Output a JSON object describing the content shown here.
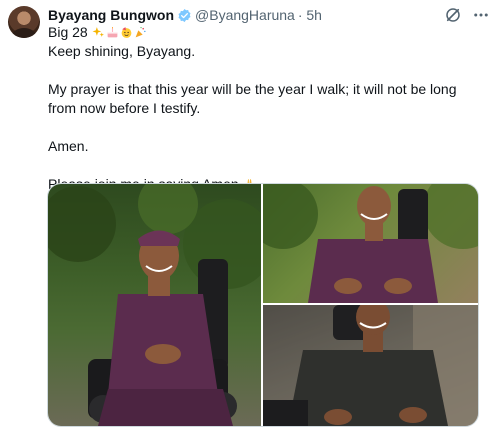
{
  "author": {
    "name": "Byayang Bungwon",
    "handle": "@ByangHaruna",
    "time": "· 5h",
    "verified_color": "#7ec8ff"
  },
  "post": {
    "line1": "Big 28",
    "line2": "Keep shining, Byayang.",
    "line3": "My prayer is that this year will be the year I walk; it will not be long from now before I testify.",
    "line4": "Amen.",
    "line5": "Please join me in saying Amen"
  },
  "icons": {
    "line1_emojis": [
      "sparkles-emoji",
      "birthday-cake-emoji",
      "party-face-emoji",
      "party-popper-emoji"
    ],
    "line5_emoji": "folded-hands-emoji",
    "header": [
      "grok-icon",
      "more-icon"
    ]
  },
  "colors": {
    "text": "#0f1419",
    "secondary": "#536471",
    "suit": "#5b2c4e"
  }
}
